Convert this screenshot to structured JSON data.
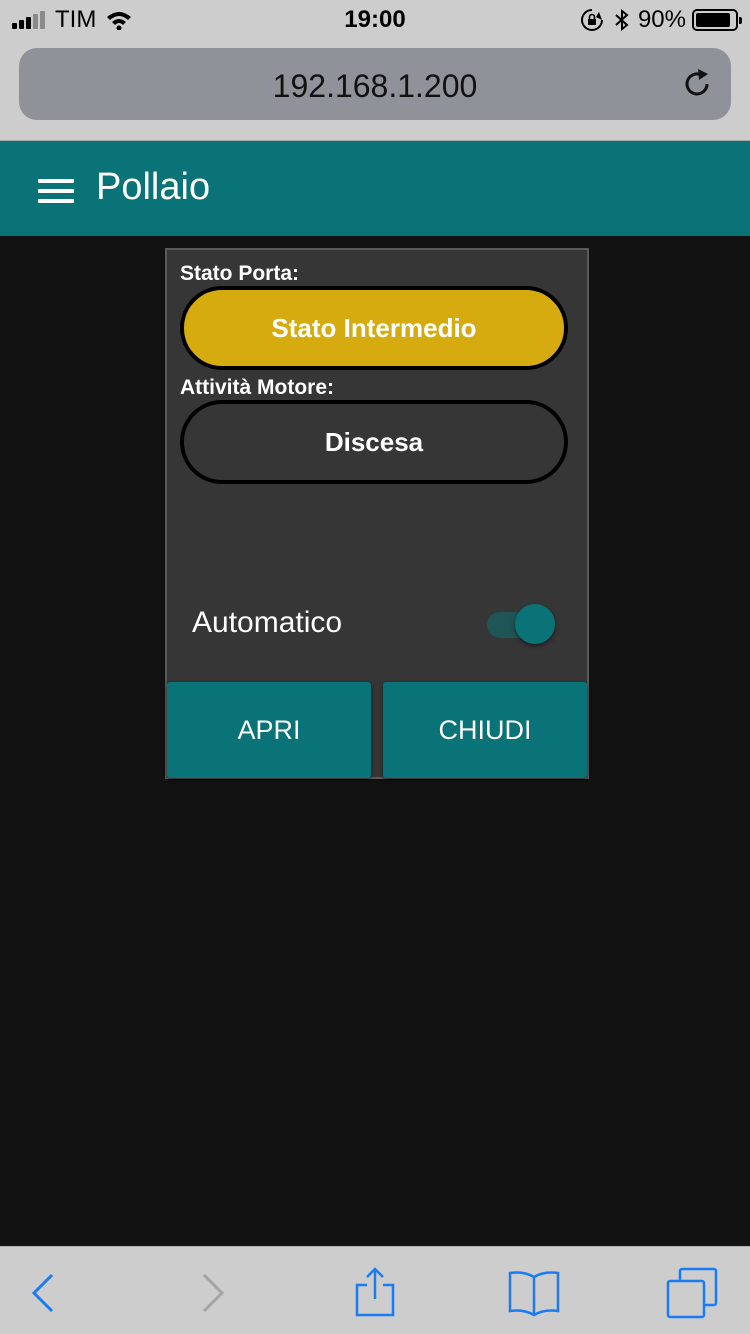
{
  "status_bar": {
    "carrier": "TIM",
    "time": "19:00",
    "battery_percent": "90%",
    "battery_level": 0.9,
    "signal_bars": 3
  },
  "browser": {
    "url": "192.168.1.200"
  },
  "app": {
    "title": "Pollaio",
    "accent_color": "#097377"
  },
  "card": {
    "door_state_label": "Stato Porta:",
    "door_state_value": "Stato Intermedio",
    "door_state_color": "#d6ab10",
    "motor_label": "Attività Motore:",
    "motor_value": "Discesa",
    "auto_label": "Automatico",
    "auto_enabled": true,
    "open_button": "APRI",
    "close_button": "CHIUDI"
  },
  "toolbar": {
    "icons": [
      "back-icon",
      "forward-icon",
      "share-icon",
      "bookmarks-icon",
      "tabs-icon"
    ]
  }
}
